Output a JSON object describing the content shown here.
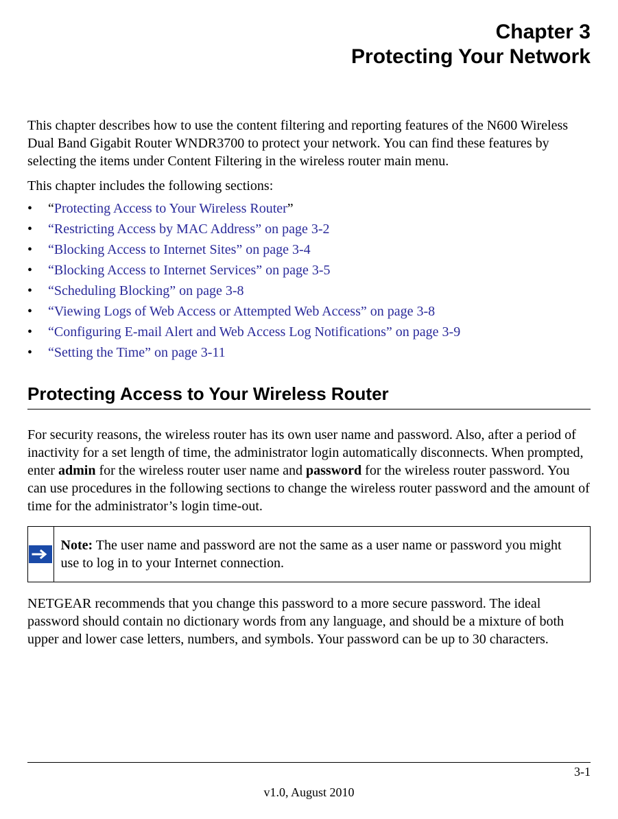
{
  "chapter": {
    "number": "Chapter 3",
    "title": "Protecting Your Network"
  },
  "intro": "This chapter describes how to use the content filtering and reporting features of the N600 Wireless Dual Band Gigabit Router WNDR3700 to protect your network. You can find these features by selecting the items under Content Filtering in the wireless router main menu.",
  "sections_intro": "This chapter includes the following sections:",
  "toc": [
    {
      "pre": "“",
      "link": "Protecting Access to Your Wireless Router",
      "post": "”"
    },
    {
      "pre": "",
      "link": "“Restricting Access by MAC Address” on page 3-2",
      "post": ""
    },
    {
      "pre": "",
      "link": "“Blocking Access to Internet Sites” on page 3-4",
      "post": ""
    },
    {
      "pre": "",
      "link": "“Blocking Access to Internet Services” on page 3-5",
      "post": ""
    },
    {
      "pre": "",
      "link": "“Scheduling Blocking” on page 3-8",
      "post": ""
    },
    {
      "pre": "",
      "link": "“Viewing Logs of Web Access or Attempted Web Access” on page 3-8",
      "post": ""
    },
    {
      "pre": "",
      "link": "“Configuring E-mail Alert and Web Access Log Notifications” on page 3-9",
      "post": ""
    },
    {
      "pre": "",
      "link": "“Setting the Time” on page 3-11",
      "post": ""
    }
  ],
  "section_heading": "Protecting Access to Your Wireless Router",
  "body1": {
    "t1": "For security reasons, the wireless router has its own user name and password. Also, after a period of inactivity for a set length of time, the administrator login automatically disconnects. When prompted, enter ",
    "b1": "admin",
    "t2": " for the wireless router user name and ",
    "b2": "password",
    "t3": " for the wireless router password. You can use procedures in the following sections to change the wireless router password and the amount of time for the administrator’s login time-out."
  },
  "note": {
    "label": "Note:",
    "text": " The user name and password are not the same as a user name or password you might use to log in to your Internet connection."
  },
  "body2": "NETGEAR recommends that you change this password to a more secure password. The ideal password should contain no dictionary words from any language, and should be a mixture of both upper and lower case letters, numbers, and symbols. Your password can be up to 30 characters.",
  "footer": {
    "page_number": "3-1",
    "version": "v1.0, August 2010"
  }
}
